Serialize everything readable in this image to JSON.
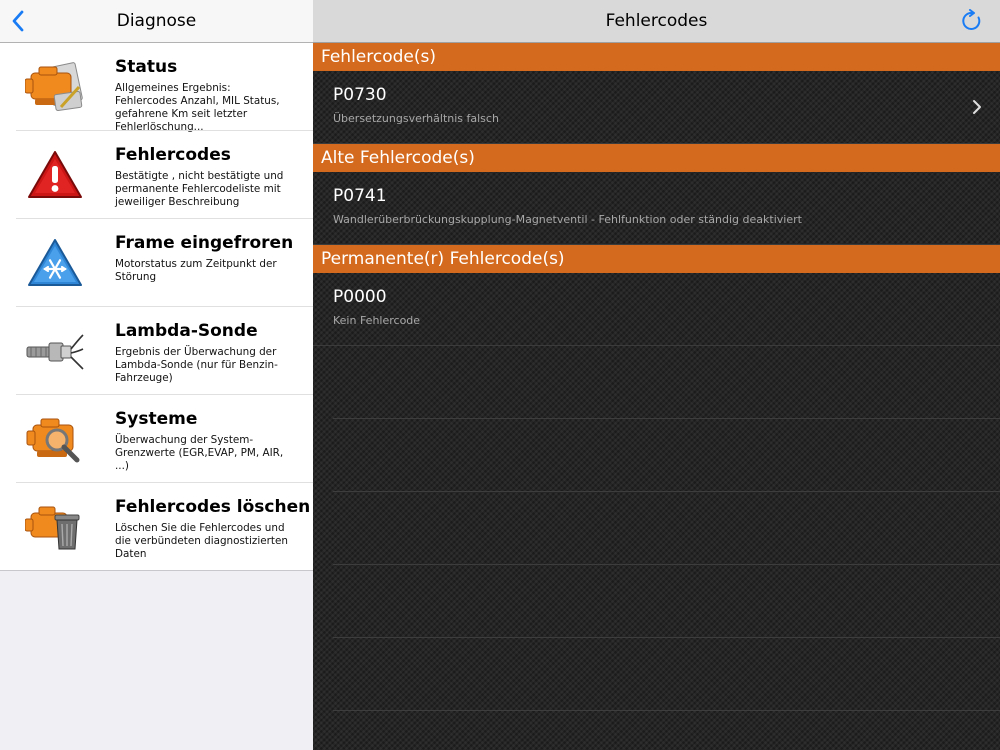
{
  "left": {
    "title": "Diagnose",
    "back_icon": "chevron-left-icon",
    "items": [
      {
        "title": "Status",
        "desc": "Allgemeines Ergebnis: Fehlercodes Anzahl, MIL Status, gefahrene Km seit letzter Fehlerlöschung...",
        "icon": "engine-report-icon"
      },
      {
        "title": "Fehlercodes",
        "desc": "Bestätigte , nicht bestätigte und permanente Fehlercodeliste mit jeweiliger Beschreibung",
        "icon": "warning-triangle-icon"
      },
      {
        "title": "Frame eingefroren",
        "desc": "Motorstatus zum Zeitpunkt der Störung",
        "icon": "snowflake-triangle-icon"
      },
      {
        "title": "Lambda-Sonde",
        "desc": "Ergebnis der Überwachung der Lambda-Sonde (nur für Benzin-Fahrzeuge)",
        "icon": "oxygen-sensor-icon"
      },
      {
        "title": "Systeme",
        "desc": "Überwachung der System-Grenzwerte (EGR,EVAP, PM, AIR, ...)",
        "icon": "engine-magnifier-icon"
      },
      {
        "title": "Fehlercodes löschen",
        "desc": "Löschen Sie die Fehlercodes und die verbündeten diagnostizierten Daten",
        "icon": "engine-trash-icon"
      }
    ]
  },
  "right": {
    "title": "Fehlercodes",
    "refresh_icon": "refresh-icon",
    "sections": [
      {
        "header": "Fehlercode(s)",
        "code": "P0730",
        "desc": "Übersetzungsverhältnis falsch"
      },
      {
        "header": "Alte Fehlercode(s)",
        "code": "P0741",
        "desc": "Wandlerüberbrückungskupplung-Magnetventil - Fehlfunktion oder ständig deaktiviert"
      },
      {
        "header": "Permanente(r) Fehlercode(s)",
        "code": "P0000",
        "desc": "Kein Fehlercode"
      }
    ]
  },
  "colors": {
    "accent_orange": "#d46a1d",
    "ios_blue": "#1a7cf5"
  }
}
